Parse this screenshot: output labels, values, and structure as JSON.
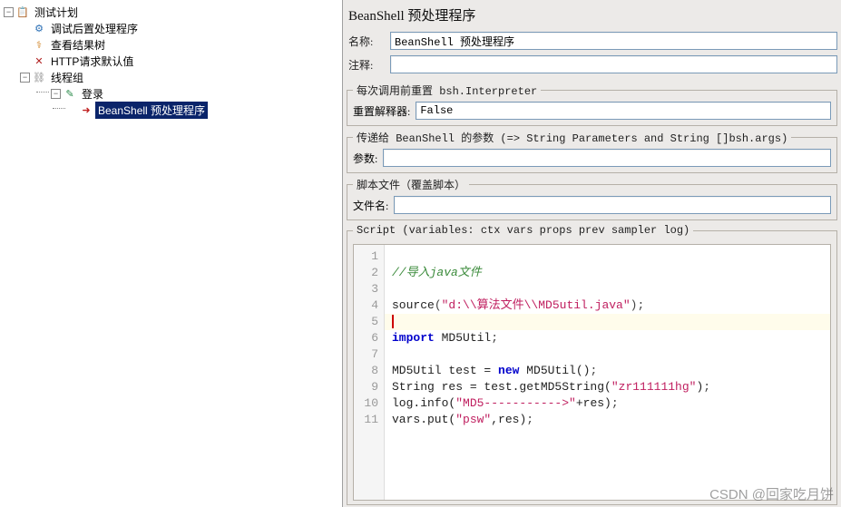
{
  "tree": {
    "root_label": "测试计划",
    "items": [
      {
        "label": "调试后置处理程序",
        "icon": "⚙",
        "color": "#2a6fb5"
      },
      {
        "label": "查看结果树",
        "icon": "⚕",
        "color": "#d08020"
      },
      {
        "label": "HTTP请求默认值",
        "icon": "✕",
        "color": "#b02020"
      }
    ],
    "thread_group": "线程组",
    "login": "登录",
    "beanshell_node": "BeanShell 预处理程序"
  },
  "panel": {
    "title": "BeanShell 预处理程序",
    "name_label": "名称:",
    "name_value": "BeanShell 预处理程序",
    "comment_label": "注释:",
    "comment_value": "",
    "reset_legend": "每次调用前重置 bsh.Interpreter",
    "reset_label": "重置解释器:",
    "reset_value": "False",
    "params_legend": "传递给 BeanShell 的参数 (=> String Parameters and String []bsh.args)",
    "params_label": "参数:",
    "params_value": "",
    "scriptfile_legend": "脚本文件（覆盖脚本）",
    "scriptfile_label": "文件名:",
    "scriptfile_value": "",
    "script_legend": "Script (variables: ctx vars props prev sampler log)"
  },
  "code": {
    "l1_num": "1",
    "l2_num": "2",
    "l2_comment": "//导入java文件",
    "l3_num": "3",
    "l4_num": "4",
    "l4_fn": "source",
    "l4_paren_o": "(",
    "l4_str": "\"d:\\\\算法文件\\\\MD5util.java\"",
    "l4_paren_c": ")",
    "l4_semi": ";",
    "l5_num": "5",
    "l6_num": "6",
    "l6_kw": "import",
    "l6_ident": " MD5Util",
    "l6_semi": ";",
    "l7_num": "7",
    "l8_num": "8",
    "l8_text1": "MD5Util test = ",
    "l8_kw": "new",
    "l8_text2": " MD5Util()",
    "l8_semi": ";",
    "l9_num": "9",
    "l9_text1": "String res = test.getMD5String(",
    "l9_str": "\"zr111111hg\"",
    "l9_text2": ")",
    "l9_semi": ";",
    "l10_num": "10",
    "l10_text1": "log.info(",
    "l10_str": "\"MD5----------->\"",
    "l10_text2": "+res)",
    "l10_semi": ";",
    "l11_num": "11",
    "l11_text1": "vars.put(",
    "l11_str": "\"psw\"",
    "l11_text2": ",res)",
    "l11_semi": ";"
  },
  "watermark": "CSDN @回家吃月饼"
}
